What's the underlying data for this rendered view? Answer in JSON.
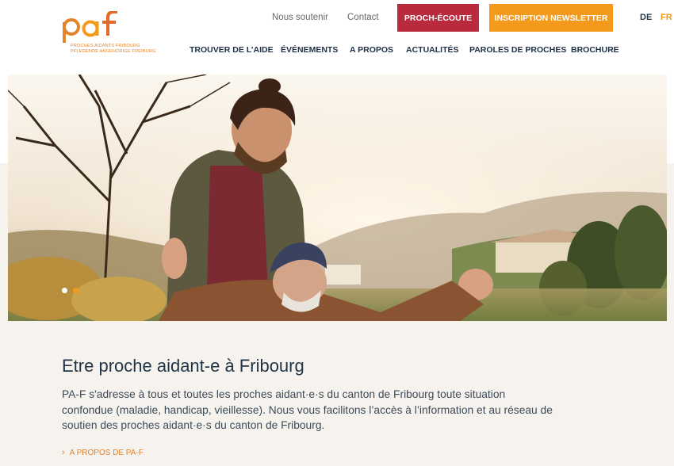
{
  "logo": {
    "mark": "paf",
    "line1": "PROCHES AIDANTS FRIBOURG",
    "line2": "PFLEGENDE ANGEHÖRIGE FREIBURG"
  },
  "utility_nav": {
    "support": "Nous soutenir",
    "contact": "Contact"
  },
  "buttons": {
    "proch_ecoute": "PROCH-ÉCOUTE",
    "newsletter": "INSCRIPTION NEWSLETTER"
  },
  "languages": [
    {
      "code": "DE",
      "active": false
    },
    {
      "code": "FR",
      "active": true
    }
  ],
  "main_nav": [
    {
      "label": "TROUVER DE L’AIDE"
    },
    {
      "label": "ÉVÉNEMENTS"
    },
    {
      "label": "A PROPOS"
    },
    {
      "label": "ACTUALITÉS"
    },
    {
      "label": "PAROLES DE PROCHES"
    },
    {
      "label": "BROCHURE"
    }
  ],
  "carousel": {
    "slide_count": 2,
    "active_index": 0
  },
  "content": {
    "title": "Etre proche aidant-e à Fribourg",
    "body": "PA-F s'adresse à tous et toutes les proches aidant·e·s du canton de Fribourg toute situation confondue (maladie, handicap, vieillesse). Nous vous facilitons l’accès à l’information et au réseau de soutien des proches aidant·e·s du canton de Fribourg.",
    "more_link": "A PROPOS DE PA-F",
    "more_icon": "chevron-right-icon"
  },
  "colors": {
    "brand_orange": "#f39a1c",
    "brand_red": "#b82a3c",
    "navy": "#1f3547",
    "band": "#f6f3ee"
  }
}
